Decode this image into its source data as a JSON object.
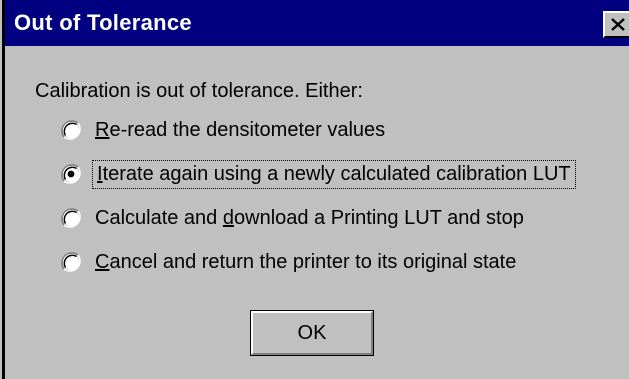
{
  "window": {
    "title": "Out of Tolerance",
    "close_icon": "close-x-icon"
  },
  "message": "Calibration is out of tolerance.  Either:",
  "options": [
    {
      "pre": "",
      "mnemonic": "R",
      "post": "e-read the densitometer values",
      "selected": false
    },
    {
      "pre": "",
      "mnemonic": "I",
      "post": "terate again using a newly calculated calibration LUT",
      "selected": true
    },
    {
      "pre": "Calculate and ",
      "mnemonic": "d",
      "post": "ownload a Printing LUT and stop",
      "selected": false
    },
    {
      "pre": "",
      "mnemonic": "C",
      "post": "ancel and return the printer to its original state",
      "selected": false
    }
  ],
  "ok_label": "OK",
  "colors": {
    "titlebar": "#000080",
    "face": "#c0c0c0"
  }
}
